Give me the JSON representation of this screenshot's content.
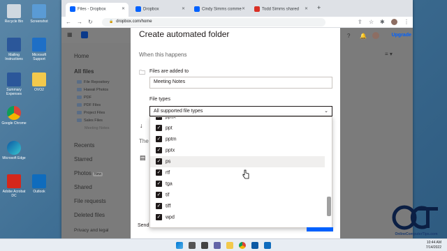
{
  "desktop": {
    "icons": [
      {
        "name": "recycle-bin-icon",
        "label": "Recycle Bin"
      },
      {
        "name": "word-doc-icon",
        "label": "Mailing Instructions"
      },
      {
        "name": "word-doc-icon-2",
        "label": "Summary Expenses"
      },
      {
        "name": "chrome-icon",
        "label": "Google Chrome"
      },
      {
        "name": "edge-icon",
        "label": "Microsoft Edge"
      },
      {
        "name": "acrobat-icon",
        "label": "Adobe Acrobat DC"
      },
      {
        "name": "screenshot-icon",
        "label": "Screenshot"
      },
      {
        "name": "support-icon",
        "label": "Microsoft Support"
      },
      {
        "name": "folder-icon",
        "label": "OVO2"
      },
      {
        "name": "outlook-icon",
        "label": "Outlook"
      }
    ]
  },
  "browser": {
    "tabs": [
      {
        "label": "Files - Dropbox",
        "color": "#0061fe"
      },
      {
        "label": "Dropbox",
        "color": "#0061fe"
      },
      {
        "label": "Cindy Simms comme",
        "color": "#0061fe"
      },
      {
        "label": "Todd Simms shared",
        "color": "#d93025"
      }
    ],
    "new_tab": "+",
    "url": "dropbox.com/home"
  },
  "sidebar": {
    "home": "Home",
    "all_files": "All files",
    "folders": [
      "File Repository",
      "Hawaii Photos",
      "PDF",
      "PDF Files",
      "Project Files",
      "Sales Files",
      "Meeting Notes"
    ],
    "recents": "Recents",
    "starred": "Starred",
    "photos": "Photos",
    "photos_badge": "New",
    "shared": "Shared",
    "file_requests": "File requests",
    "deleted_files": "Deleted files",
    "privacy": "Privacy and legal"
  },
  "header": {
    "upgrade": "Upgrade"
  },
  "modal": {
    "title": "Create automated folder",
    "when_label": "When this happens",
    "trigger": "Files are added to",
    "folder_value": "Meeting Notes",
    "file_types_label": "File types",
    "file_types_value": "All supported file types",
    "partial_label": "The",
    "footer_button": "Send",
    "options": [
      "ppsx",
      "ppt",
      "pptm",
      "pptx",
      "ps",
      "rtf",
      "tga",
      "tif",
      "tiff",
      "wpd"
    ]
  },
  "taskbar": {
    "time": "10:44 AM",
    "date": "7/14/2022"
  },
  "watermark": {
    "logo": "OCT",
    "site": "OnlineComputerTips.com"
  }
}
